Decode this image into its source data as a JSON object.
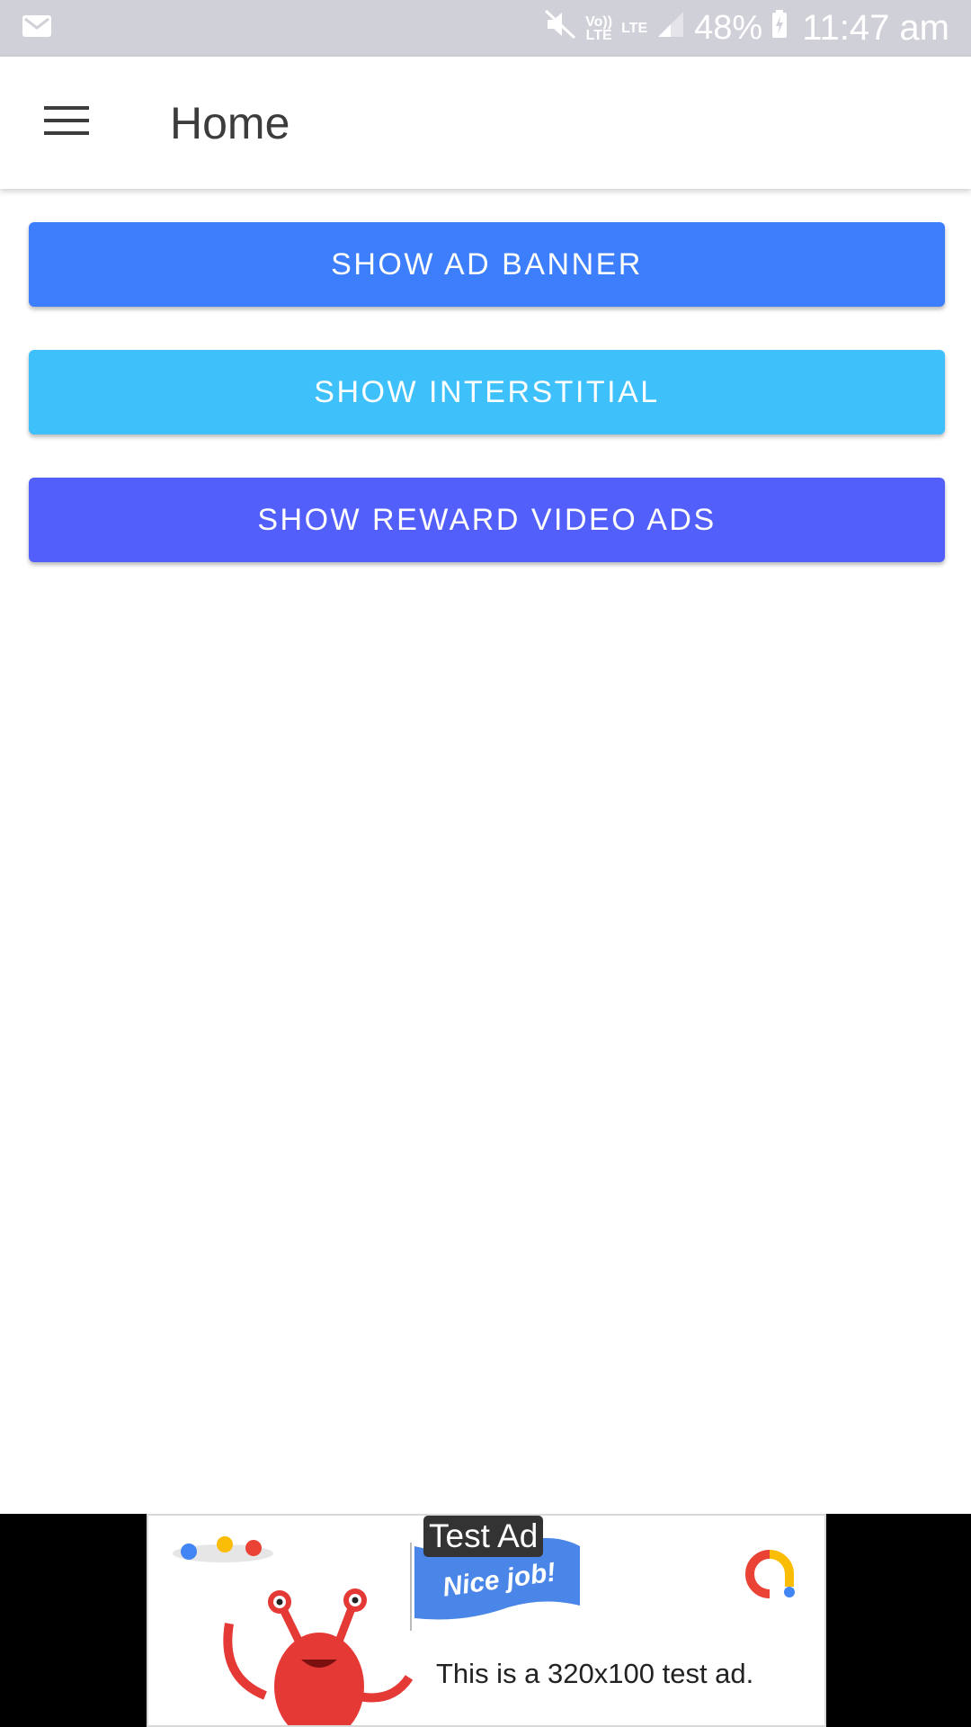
{
  "status_bar": {
    "battery": "48%",
    "time": "11:47 am",
    "volte_label": "Vo))\nLTE",
    "lte_label": "LTE"
  },
  "app_bar": {
    "title": "Home",
    "menu_icon": "hamburger-menu-icon"
  },
  "buttons": [
    {
      "label": "SHOW AD BANNER",
      "color": "#3c7efb"
    },
    {
      "label": "SHOW INTERSTITIAL",
      "color": "#3ec0fb"
    },
    {
      "label": "SHOW REWARD VIDEO ADS",
      "color": "#535ffb"
    }
  ],
  "ad": {
    "label": "Test Ad",
    "flag_text": "Nice job!",
    "text": "This is a 320x100 test ad."
  }
}
